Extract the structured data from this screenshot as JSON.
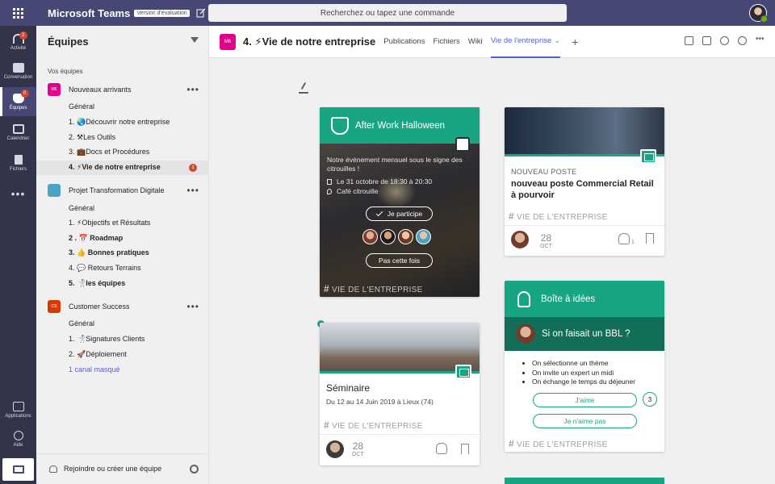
{
  "app": {
    "title": "Microsoft Teams",
    "badge": "Version d'évaluation",
    "search_placeholder": "Recherchez ou tapez une commande"
  },
  "rail": {
    "items": [
      {
        "label": "Activité",
        "badge": "2"
      },
      {
        "label": "Conversation"
      },
      {
        "label": "Équipes",
        "badge": "0"
      },
      {
        "label": "Calendrier"
      },
      {
        "label": "Fichiers"
      }
    ],
    "more": "•••",
    "bottom": [
      {
        "label": "Applications"
      },
      {
        "label": "Aide"
      }
    ]
  },
  "panel": {
    "title": "Équipes",
    "section_label": "Vos équipes",
    "teams": [
      {
        "tile": "M6",
        "tile_color": "#e3008c",
        "name": "Nouveaux arrivants",
        "more": "•••",
        "channels": [
          {
            "label": "Général",
            "bold": false
          },
          {
            "label": "1. 🌏Découvrir notre entreprise",
            "bold": false
          },
          {
            "label": "2. ⚒Les Outils",
            "bold": false
          },
          {
            "label": "3. 💼Docs et Procédures",
            "bold": false
          },
          {
            "label": "4. ⚡Vie de notre entreprise",
            "bold": true,
            "badge": "1"
          }
        ]
      },
      {
        "tile": "",
        "tile_color": "#4aa3c7",
        "name": "Projet Transformation Digitale",
        "more": "•••",
        "channels": [
          {
            "label": "Général",
            "bold": false
          },
          {
            "label": "1. ⚡Objectifs et Résultats",
            "bold": false
          },
          {
            "label": "2 . 📅 Roadmap",
            "bold": true
          },
          {
            "label": "3. 👍 Bonnes pratiques",
            "bold": true
          },
          {
            "label": "4. 💬 Retours Terrains",
            "bold": false
          },
          {
            "label": "5. 🤺les équipes",
            "bold": true
          }
        ]
      },
      {
        "tile": "CS",
        "tile_color": "#d83b01",
        "name": "Customer Success",
        "more": "•••",
        "channels": [
          {
            "label": "Général",
            "bold": false
          },
          {
            "label": "1. 🤺Signatures Clients",
            "bold": false
          },
          {
            "label": "2. 🚀Déploiement",
            "bold": false
          }
        ],
        "hidden_link": "1 canal masqué"
      }
    ],
    "join_label": "Rejoindre ou créer une équipe"
  },
  "channel_header": {
    "tile": "M6",
    "title": "4. ⚡Vie de notre entreprise",
    "tabs": [
      "Publications",
      "Fichiers",
      "Wiki",
      "Vie de l'entreprise"
    ],
    "active_tab_suffix": "⌄",
    "add": "+"
  },
  "cards": {
    "halloween": {
      "title": "After Work Halloween",
      "description": "Notre évènement mensuel sous le signe des citrouilles !",
      "date": "Le 31 octobre de 18:30 à 20:30",
      "place": "Café citrouille",
      "join_button": "Je participe",
      "decline_button": "Pas cette fois",
      "tag": "VIE DE L'ENTREPRISE"
    },
    "seminar": {
      "title": "Séminaire",
      "subtitle": "Du 12 au 14 Juin 2019 à Lieux (74)",
      "tag": "VIE DE L'ENTREPRISE",
      "day": "28",
      "month": "OCT"
    },
    "job": {
      "kicker": "NOUVEAU POSTE",
      "title": "nouveau poste Commercial Retail à pourvoir",
      "tag": "VIE DE L'ENTREPRISE",
      "day": "28",
      "month": "OCT",
      "claps": "1"
    },
    "ideas": {
      "title": "Boîte à idées",
      "question": "Si on faisait un BBL ?",
      "bullets": [
        "On sélectionne un thème",
        "On invite un expert un midi",
        "On échange le temps du déjeuner"
      ],
      "like_button": "J'aime",
      "like_count": "3",
      "dislike_button": "Je n'aime pas",
      "tag": "VIE DE L'ENTREPRISE"
    }
  },
  "colors": {
    "topbar": "#464775",
    "rail": "#33344a",
    "accent": "#5b5fc7",
    "card_teal": "#18a583",
    "badge_red": "#cc4a31"
  }
}
